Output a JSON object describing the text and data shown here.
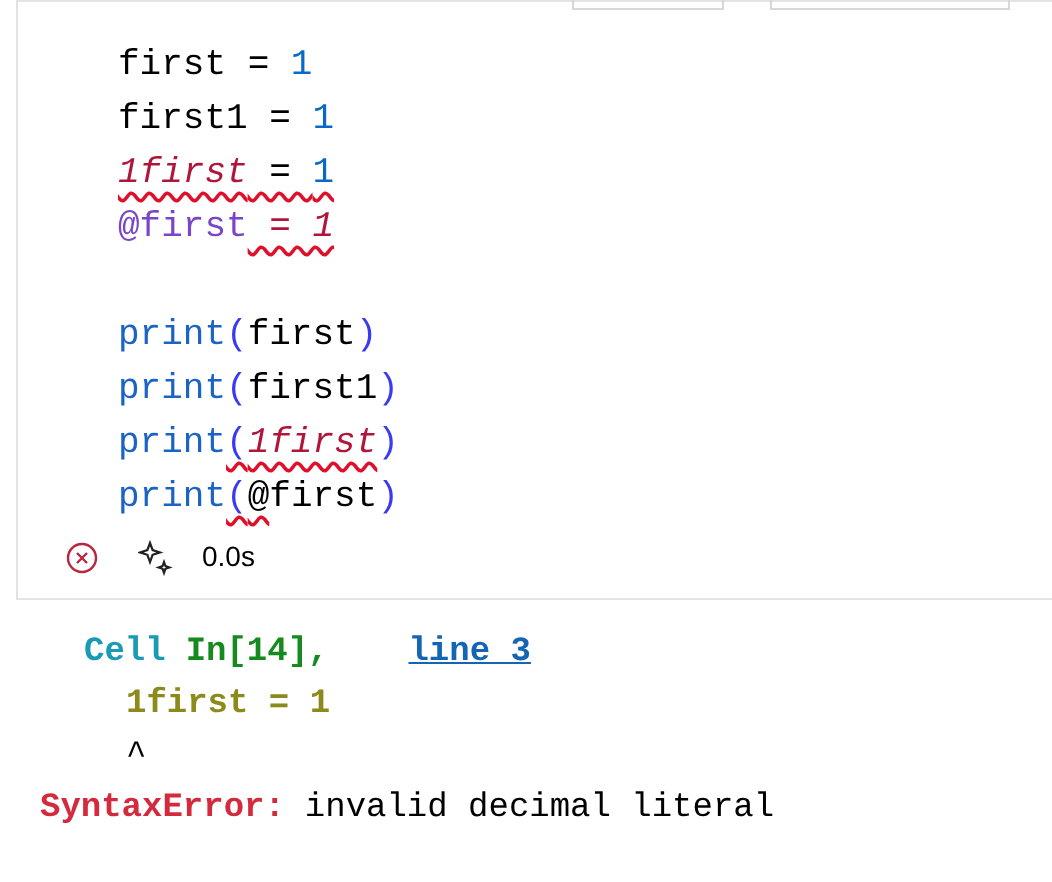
{
  "cell": {
    "lines": [
      {
        "kind": "code",
        "tokens": [
          {
            "text": "first",
            "kind": "name",
            "squiggle": false
          },
          {
            "text": " = ",
            "kind": "op",
            "squiggle": false
          },
          {
            "text": "1",
            "kind": "number",
            "squiggle": false
          }
        ]
      },
      {
        "kind": "code",
        "tokens": [
          {
            "text": "first1",
            "kind": "name",
            "squiggle": false
          },
          {
            "text": " = ",
            "kind": "op",
            "squiggle": false
          },
          {
            "text": "1",
            "kind": "number",
            "squiggle": false
          }
        ]
      },
      {
        "kind": "code",
        "tokens": [
          {
            "text": "1first",
            "kind": "invalid",
            "squiggle": true
          },
          {
            "text": " = ",
            "kind": "op",
            "squiggle": true
          },
          {
            "text": "1",
            "kind": "number",
            "squiggle": true
          }
        ]
      },
      {
        "kind": "code",
        "tokens": [
          {
            "text": "@first",
            "kind": "decorator",
            "squiggle": false
          },
          {
            "text": " = 1",
            "kind": "invalid",
            "squiggle": true
          }
        ]
      },
      {
        "kind": "blank"
      },
      {
        "kind": "code",
        "tokens": [
          {
            "text": "print",
            "kind": "func",
            "squiggle": false
          },
          {
            "text": "(",
            "kind": "paren",
            "squiggle": false
          },
          {
            "text": "first",
            "kind": "name",
            "squiggle": false
          },
          {
            "text": ")",
            "kind": "paren",
            "squiggle": false
          }
        ]
      },
      {
        "kind": "code",
        "tokens": [
          {
            "text": "print",
            "kind": "func",
            "squiggle": false
          },
          {
            "text": "(",
            "kind": "paren",
            "squiggle": false
          },
          {
            "text": "first1",
            "kind": "name",
            "squiggle": false
          },
          {
            "text": ")",
            "kind": "paren",
            "squiggle": false
          }
        ]
      },
      {
        "kind": "code",
        "tokens": [
          {
            "text": "print",
            "kind": "func",
            "squiggle": false
          },
          {
            "text": "(",
            "kind": "paren",
            "squiggle": true
          },
          {
            "text": "1first",
            "kind": "invalid",
            "squiggle": true
          },
          {
            "text": ")",
            "kind": "paren",
            "squiggle": false
          }
        ]
      },
      {
        "kind": "code",
        "tokens": [
          {
            "text": "print",
            "kind": "func",
            "squiggle": false
          },
          {
            "text": "(",
            "kind": "paren",
            "squiggle": true
          },
          {
            "text": "@",
            "kind": "name",
            "squiggle": true
          },
          {
            "text": "first",
            "kind": "name",
            "squiggle": false
          },
          {
            "text": ")",
            "kind": "paren",
            "squiggle": false
          }
        ]
      }
    ],
    "status": {
      "failed": true,
      "duration": "0.0s"
    }
  },
  "output": {
    "lines": [
      {
        "kind": "header",
        "tokens": [
          {
            "text": "Cell",
            "kind": "label"
          },
          {
            "text": "In[14],",
            "kind": "location"
          },
          {
            "text": "line 3",
            "kind": "link"
          }
        ]
      },
      {
        "kind": "source",
        "tokens": [
          {
            "text": "1first = 1",
            "kind": "source"
          }
        ]
      },
      {
        "kind": "caret",
        "tokens": [
          {
            "text": "^",
            "kind": "plain"
          }
        ]
      },
      {
        "kind": "message",
        "tokens": [
          {
            "text": "SyntaxError:",
            "kind": "error_type"
          },
          {
            "text": "invalid decimal literal",
            "kind": "plain"
          }
        ]
      }
    ]
  }
}
